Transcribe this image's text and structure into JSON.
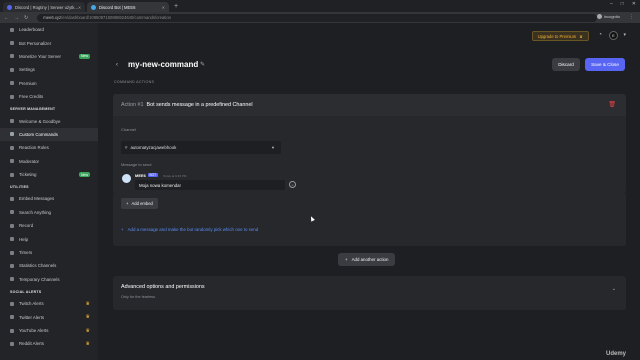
{
  "browser": {
    "tabs": [
      {
        "label": "Discord | Rogtiny | Serwer użytk...",
        "active": false
      },
      {
        "label": "Discord Bot | MEE6",
        "active": true
      }
    ],
    "new_tab": "+",
    "url_host": "mee6.xyz",
    "url_path": "/en/dashboard/1085087150880624640/commands/creation",
    "incognito_label": "Incognito"
  },
  "header": {
    "upgrade_label": "Upgrade to Premium",
    "avatar_letter": "E"
  },
  "sidebar": {
    "groups": [
      {
        "heading": "",
        "items": [
          {
            "label": "Leaderboard"
          },
          {
            "label": "Bot Personalizer"
          },
          {
            "label": "Monetize Your Server",
            "badge": "New"
          },
          {
            "label": "Settings"
          },
          {
            "label": "Premium"
          },
          {
            "label": "Free Credits"
          }
        ]
      },
      {
        "heading": "SERVER MANAGEMENT",
        "items": [
          {
            "label": "Welcome & Goodbye"
          },
          {
            "label": "Custom Commands",
            "active": true
          },
          {
            "label": "Reaction Roles"
          },
          {
            "label": "Moderator"
          },
          {
            "label": "Ticketing",
            "badge": "New"
          }
        ]
      },
      {
        "heading": "UTILITIES",
        "items": [
          {
            "label": "Embed Messages"
          },
          {
            "label": "Search Anything"
          },
          {
            "label": "Record"
          },
          {
            "label": "Help"
          },
          {
            "label": "Timers"
          },
          {
            "label": "Statistics Channels"
          },
          {
            "label": "Temporary Channels"
          }
        ]
      },
      {
        "heading": "SOCIAL ALERTS",
        "items": [
          {
            "label": "Twitch Alerts",
            "crown": true
          },
          {
            "label": "Twitter Alerts",
            "crown": true
          },
          {
            "label": "YouTube Alerts",
            "crown": true
          },
          {
            "label": "Reddit Alerts",
            "crown": true
          }
        ]
      }
    ]
  },
  "main": {
    "back_icon": "chevron-left",
    "title": "my-new-command",
    "discard_label": "Discard",
    "save_label": "Save & Close",
    "section_caption": "COMMAND ACTIONS",
    "action": {
      "number": "Action #1",
      "title": "Bot sends message in a predefined Channel",
      "channel_label": "Channel",
      "channel_value": "automatyzacjawebhook",
      "message_label": "Message to send",
      "bot_name": "MEE6",
      "bot_tag": "BOT",
      "time": "Today at 9:45 PM",
      "message_value": "Moja nowa komenda!",
      "add_embed_label": "Add embed",
      "random_link": "Add a message and make the bot randomly pick which one to send"
    },
    "add_action_label": "Add another action",
    "advanced": {
      "title": "Advanced options and permissions",
      "subtitle": "Only for the fearless"
    }
  },
  "watermark": "Udemy",
  "colors": {
    "accent": "#5865f2",
    "premium": "#f0b232",
    "danger": "#ed4245",
    "link": "#5c8df5"
  }
}
